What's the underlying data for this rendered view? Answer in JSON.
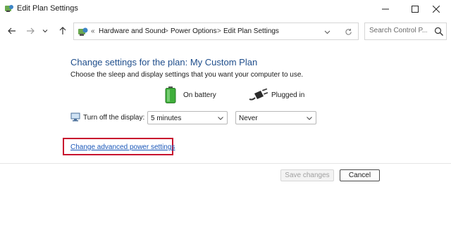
{
  "window": {
    "title": "Edit Plan Settings"
  },
  "nav": {
    "breadcrumbs": [
      "Hardware and Sound",
      "Power Options",
      "Edit Plan Settings"
    ],
    "overflow_chevron": "«",
    "separator": ">",
    "search_placeholder": "Search Control P..."
  },
  "main": {
    "heading": "Change settings for the plan: My Custom Plan",
    "description": "Choose the sleep and display settings that you want your computer to use.",
    "columns": {
      "battery_label": "On battery",
      "plugged_label": "Plugged in"
    },
    "display_setting": {
      "label": "Turn off the display:",
      "battery_value": "5 minutes",
      "plugged_value": "Never"
    },
    "advanced_link": "Change advanced power settings"
  },
  "footer": {
    "save_label": "Save changes",
    "cancel_label": "Cancel"
  },
  "colors": {
    "heading": "#1f4e8c",
    "link": "#1a56b8",
    "highlight_box": "#c8102e"
  },
  "icons": {
    "app": "control-panel-icon",
    "battery": "battery-icon",
    "plug": "power-plug-icon",
    "display": "display-icon"
  }
}
